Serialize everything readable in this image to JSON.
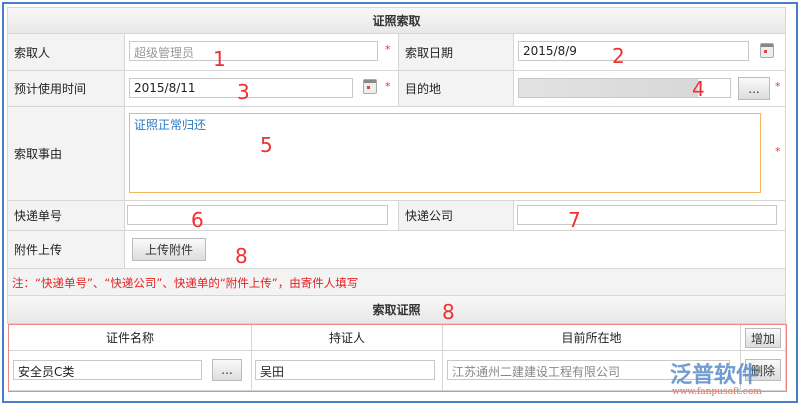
{
  "form": {
    "title": "证照索取",
    "requester_label": "索取人",
    "requester_value": "超级管理员",
    "request_date_label": "索取日期",
    "request_date_value": "2015/8/9",
    "expected_use_label": "预计使用时间",
    "expected_use_value": "2015/8/11",
    "destination_label": "目的地",
    "destination_button": "...",
    "reason_label": "索取事由",
    "reason_value": "证照正常归还",
    "tracking_label": "快递单号",
    "courier_label": "快递公司",
    "attachment_label": "附件上传",
    "attachment_button": "上传附件",
    "required_mark": "*",
    "note": "注：“快递单号”、“快递公司”、快递单的“附件上传”，由寄件人填写"
  },
  "certs": {
    "title": "索取证照",
    "columns": [
      "证件名称",
      "持证人",
      "目前所在地"
    ],
    "add_button": "增加",
    "rows": [
      {
        "name": "安全员C类",
        "picker": "...",
        "holder": "吴田",
        "location": "江苏通州二建建设工程有限公司",
        "delete": "删除"
      }
    ]
  },
  "annotations": [
    "1",
    "2",
    "3",
    "4",
    "5",
    "6",
    "7",
    "8",
    "8"
  ],
  "watermark": {
    "brand": "泛普软件",
    "url": "www.fanpusoft.com"
  }
}
